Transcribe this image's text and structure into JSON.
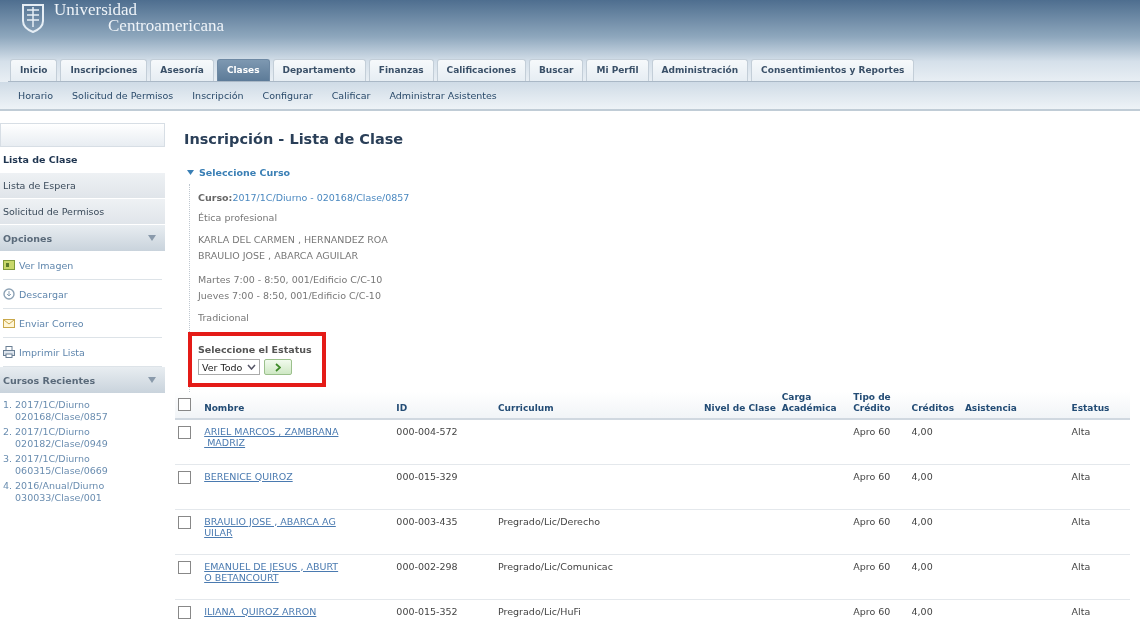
{
  "header": {
    "logo_line1": "Universidad",
    "logo_line2": "Centroamericana"
  },
  "tabs": [
    {
      "label": "Inicio",
      "selected": false
    },
    {
      "label": "Inscripciones",
      "selected": false
    },
    {
      "label": "Asesoría",
      "selected": false
    },
    {
      "label": "Clases",
      "selected": true
    },
    {
      "label": "Departamento",
      "selected": false
    },
    {
      "label": "Finanzas",
      "selected": false
    },
    {
      "label": "Calificaciones",
      "selected": false
    },
    {
      "label": "Buscar",
      "selected": false
    },
    {
      "label": "Mi Perfil",
      "selected": false
    },
    {
      "label": "Administración",
      "selected": false
    },
    {
      "label": "Consentimientos y Reportes",
      "selected": false
    }
  ],
  "subnav": [
    "Horario",
    "Solicitud de Permisos",
    "Inscripción",
    "Configurar",
    "Calificar",
    "Administrar Asistentes"
  ],
  "sidebar": {
    "items": [
      {
        "label": "Lista de Clase",
        "selected": true
      },
      {
        "label": "Lista de Espera",
        "selected": false
      },
      {
        "label": "Solicitud de Permisos",
        "selected": false
      }
    ],
    "options": {
      "title": "Opciones",
      "expanded": true,
      "items": [
        {
          "label": "Ver Imagen",
          "kind": "image"
        },
        {
          "label": "Descargar",
          "kind": "download"
        },
        {
          "label": "Enviar Correo",
          "kind": "mail"
        },
        {
          "label": "Imprimir Lista",
          "kind": "print"
        }
      ]
    },
    "recent": {
      "title": "Cursos Recientes",
      "expanded": true,
      "items": [
        {
          "number": "1.",
          "line1": "2017/1C/Diurno",
          "line2": "020168/Clase/0857"
        },
        {
          "number": "2.",
          "line1": "2017/1C/Diurno",
          "line2": "020182/Clase/0949"
        },
        {
          "number": "3.",
          "line1": "2017/1C/Diurno",
          "line2": "060315/Clase/0669"
        },
        {
          "number": "4.",
          "line1": "2016/Anual/Diurno",
          "line2": "030033/Clase/001"
        }
      ]
    }
  },
  "page_title": "Inscripción - Lista de Clase",
  "course_section": {
    "title": "Seleccione Curso",
    "expanded": true,
    "course_label": "Curso:",
    "course_value": "2017/1C/Diurno - 020168/Clase/0857",
    "subject": "Ética profesional",
    "instructors": [
      "KARLA DEL CARMEN , HERNANDEZ ROA",
      "BRAULIO JOSE , ABARCA AGUILAR"
    ],
    "schedule": [
      "Martes 7:00 - 8:50, 001/Edificio C/C-10",
      "Jueves 7:00 - 8:50, 001/Edificio C/C-10"
    ],
    "mode": "Tradicional"
  },
  "status_filter": {
    "label": "Seleccione el Estatus",
    "value": "Ver Todo",
    "highlighted": true
  },
  "table": {
    "select_all_checked": false,
    "columns": [
      "Nombre",
      "ID",
      "Curriculum",
      "Nivel de Clase",
      "Carga Académica",
      "Tipo de Crédito",
      "Créditos",
      "Asistencia",
      "Estatus"
    ],
    "rows": [
      {
        "checked": false,
        "name": [
          "ARIEL MARCOS , ZAMBRANA",
          " MADRIZ"
        ],
        "id": "000-004-572",
        "credit_type": "Apro 60",
        "credits": "4,00",
        "status": "Alta"
      },
      {
        "checked": false,
        "name": [
          "BERENICE QUIROZ"
        ],
        "id": "000-015-329",
        "credit_type": "Apro 60",
        "credits": "4,00",
        "status": "Alta"
      },
      {
        "checked": false,
        "name": [
          "BRAULIO JOSE , ABARCA AG",
          "UILAR"
        ],
        "id": "000-003-435",
        "curriculum": "Pregrado/Lic/Derecho",
        "credit_type": "Apro 60",
        "credits": "4,00",
        "status": "Alta"
      },
      {
        "checked": false,
        "name": [
          "EMANUEL DE JESUS , ABURT",
          "O BETANCOURT"
        ],
        "id": "000-002-298",
        "curriculum": "Pregrado/Lic/Comunicac",
        "credit_type": "Apro 60",
        "credits": "4,00",
        "status": "Alta"
      },
      {
        "checked": false,
        "name": [
          "ILIANA  QUIROZ ARRON"
        ],
        "id": "000-015-352",
        "curriculum": "Pregrado/Lic/HuFi",
        "credit_type": "Apro 60",
        "credits": "4,00",
        "status": "Alta"
      }
    ]
  }
}
